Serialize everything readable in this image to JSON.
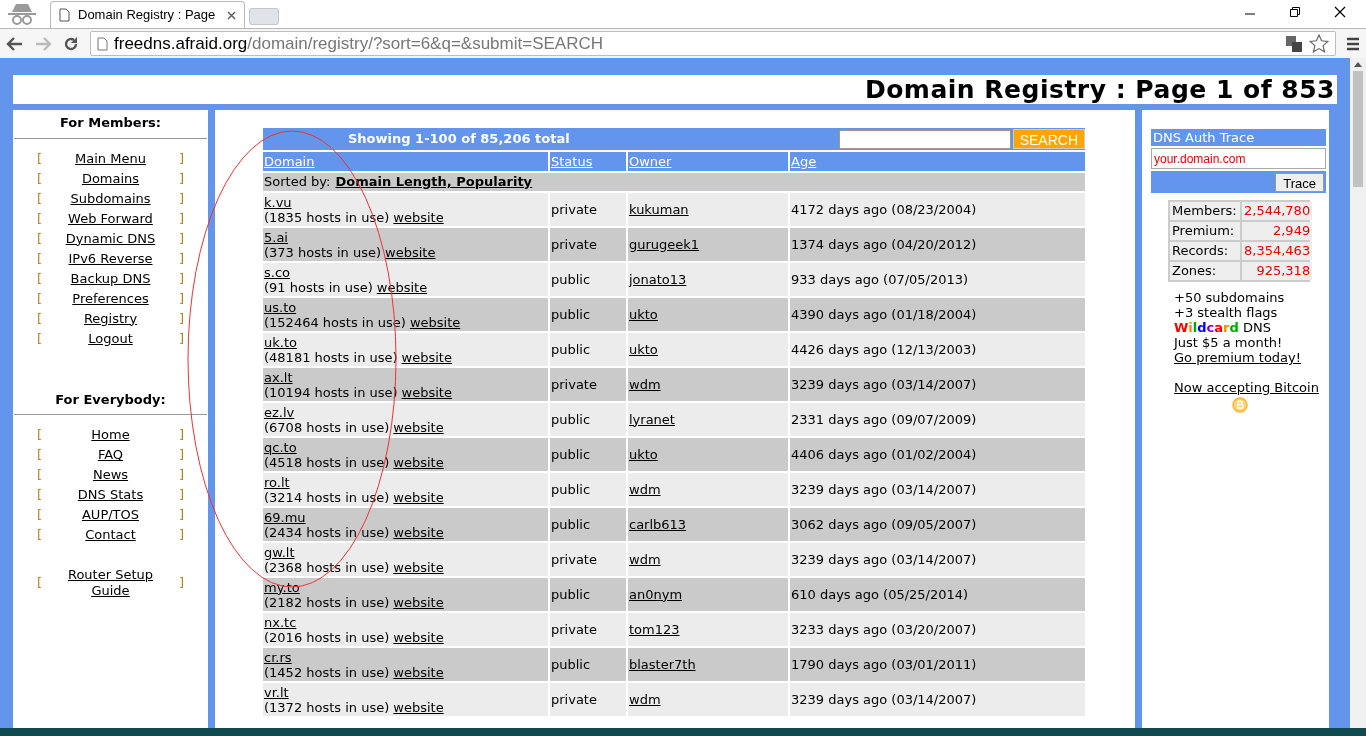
{
  "browser": {
    "tab_title": "Domain Registry : Page",
    "url_host": "freedns.afraid.org",
    "url_path": "/domain/registry/?sort=6&q=&submit=SEARCH"
  },
  "page_title": "Domain Registry : Page 1 of 853",
  "sidebar": {
    "sections": [
      {
        "heading": "For Members:",
        "links": [
          {
            "open": "[",
            "label": "Main Menu",
            "close": "]"
          },
          {
            "open": "[",
            "label": "Domains",
            "close": "]"
          },
          {
            "open": "[",
            "label": "Subdomains",
            "close": "]"
          },
          {
            "open": "[",
            "label": "Web Forward",
            "close": "]"
          },
          {
            "open": "[",
            "label": "Dynamic DNS",
            "close": "]"
          },
          {
            "open": "[",
            "label": "IPv6 Reverse",
            "close": "]"
          },
          {
            "open": "[",
            "label": "Backup DNS",
            "close": "]"
          },
          {
            "open": "[",
            "label": "Preferences",
            "close": "]"
          },
          {
            "open": "[",
            "label": "Registry",
            "close": "]"
          },
          {
            "open": "[",
            "label": "Logout",
            "close": "]"
          }
        ]
      },
      {
        "heading": "For Everybody:",
        "links": [
          {
            "open": "[",
            "label": "Home",
            "close": "]"
          },
          {
            "open": "[",
            "label": "FAQ",
            "close": "]"
          },
          {
            "open": "[",
            "label": "News",
            "close": "]"
          },
          {
            "open": "[",
            "label": "DNS Stats",
            "close": "]"
          },
          {
            "open": "[",
            "label": "AUP/TOS",
            "close": "]"
          },
          {
            "open": "[",
            "label": "Contact",
            "close": "]"
          }
        ]
      }
    ],
    "extra_link": {
      "open": "[",
      "lines": [
        "Router Setup",
        "Guide"
      ],
      "close": "]"
    }
  },
  "registry": {
    "showing": "Showing **1-100** of **85,206** total",
    "search_button": "SEARCH",
    "columns": [
      "Domain",
      "Status",
      "Owner",
      "Age"
    ],
    "sorted_label": "Sorted by:",
    "sorted_value": "Domain Length, Popularity",
    "rows": [
      {
        "domain": "k.vu",
        "hosts": "(1835 hosts in use)",
        "link": "website",
        "status": "private",
        "owner": "kukuman",
        "age": "4172 days ago (08/23/2004)"
      },
      {
        "domain": "5.ai",
        "hosts": "(373 hosts in use)",
        "link": "website",
        "status": "private",
        "owner": "gurugeek1",
        "age": "1374 days ago (04/20/2012)"
      },
      {
        "domain": "s.co",
        "hosts": "(91 hosts in use)",
        "link": "website",
        "status": "public",
        "owner": "jonato13",
        "age": "933 days ago (07/05/2013)"
      },
      {
        "domain": "us.to",
        "hosts": "(152464 hosts in use)",
        "link": "website",
        "status": "public",
        "owner": "ukto",
        "age": "4390 days ago (01/18/2004)"
      },
      {
        "domain": "uk.to",
        "hosts": "(48181 hosts in use)",
        "link": "website",
        "status": "public",
        "owner": "ukto",
        "age": "4426 days ago (12/13/2003)"
      },
      {
        "domain": "ax.lt",
        "hosts": "(10194 hosts in use)",
        "link": "website",
        "status": "private",
        "owner": "wdm",
        "age": "3239 days ago (03/14/2007)"
      },
      {
        "domain": "ez.lv",
        "hosts": "(6708 hosts in use)",
        "link": "website",
        "status": "public",
        "owner": "lyranet",
        "age": "2331 days ago (09/07/2009)"
      },
      {
        "domain": "qc.to",
        "hosts": "(4518 hosts in use)",
        "link": "website",
        "status": "public",
        "owner": "ukto",
        "age": "4406 days ago (01/02/2004)"
      },
      {
        "domain": "ro.lt",
        "hosts": "(3214 hosts in use)",
        "link": "website",
        "status": "public",
        "owner": "wdm",
        "age": "3239 days ago (03/14/2007)"
      },
      {
        "domain": "69.mu",
        "hosts": "(2434 hosts in use)",
        "link": "website",
        "status": "public",
        "owner": "carlb613",
        "age": "3062 days ago (09/05/2007)"
      },
      {
        "domain": "gw.lt",
        "hosts": "(2368 hosts in use)",
        "link": "website",
        "status": "private",
        "owner": "wdm",
        "age": "3239 days ago (03/14/2007)"
      },
      {
        "domain": "my.to",
        "hosts": "(2182 hosts in use)",
        "link": "website",
        "status": "public",
        "owner": "an0nym",
        "age": "610 days ago (05/25/2014)"
      },
      {
        "domain": "nx.tc",
        "hosts": "(2016 hosts in use)",
        "link": "website",
        "status": "private",
        "owner": "tom123",
        "age": "3233 days ago (03/20/2007)"
      },
      {
        "domain": "cr.rs",
        "hosts": "(1452 hosts in use)",
        "link": "website",
        "status": "public",
        "owner": "blaster7th",
        "age": "1790 days ago (03/01/2011)"
      },
      {
        "domain": "vr.lt",
        "hosts": "(1372 hosts in use)",
        "link": "website",
        "status": "private",
        "owner": "wdm",
        "age": "3239 days ago (03/14/2007)"
      }
    ]
  },
  "trace": {
    "title": "DNS Auth Trace",
    "value": "your.domain.com",
    "button": "Trace"
  },
  "stats": [
    {
      "label": "Members:",
      "value": "2,544,780"
    },
    {
      "label": "Premium:",
      "value": "2,949"
    },
    {
      "label": "Records:",
      "value": "8,354,463"
    },
    {
      "label": "Zones:",
      "value": "925,318"
    }
  ],
  "promo": {
    "lines": [
      "+50 subdomains",
      "+3 stealth flags"
    ],
    "wildcard": "Wildcard",
    "wildcard_rest": " DNS",
    "price": "Just $5 a month!",
    "link": "Go premium today!",
    "bitcoin": "Now accepting Bitcoin"
  }
}
